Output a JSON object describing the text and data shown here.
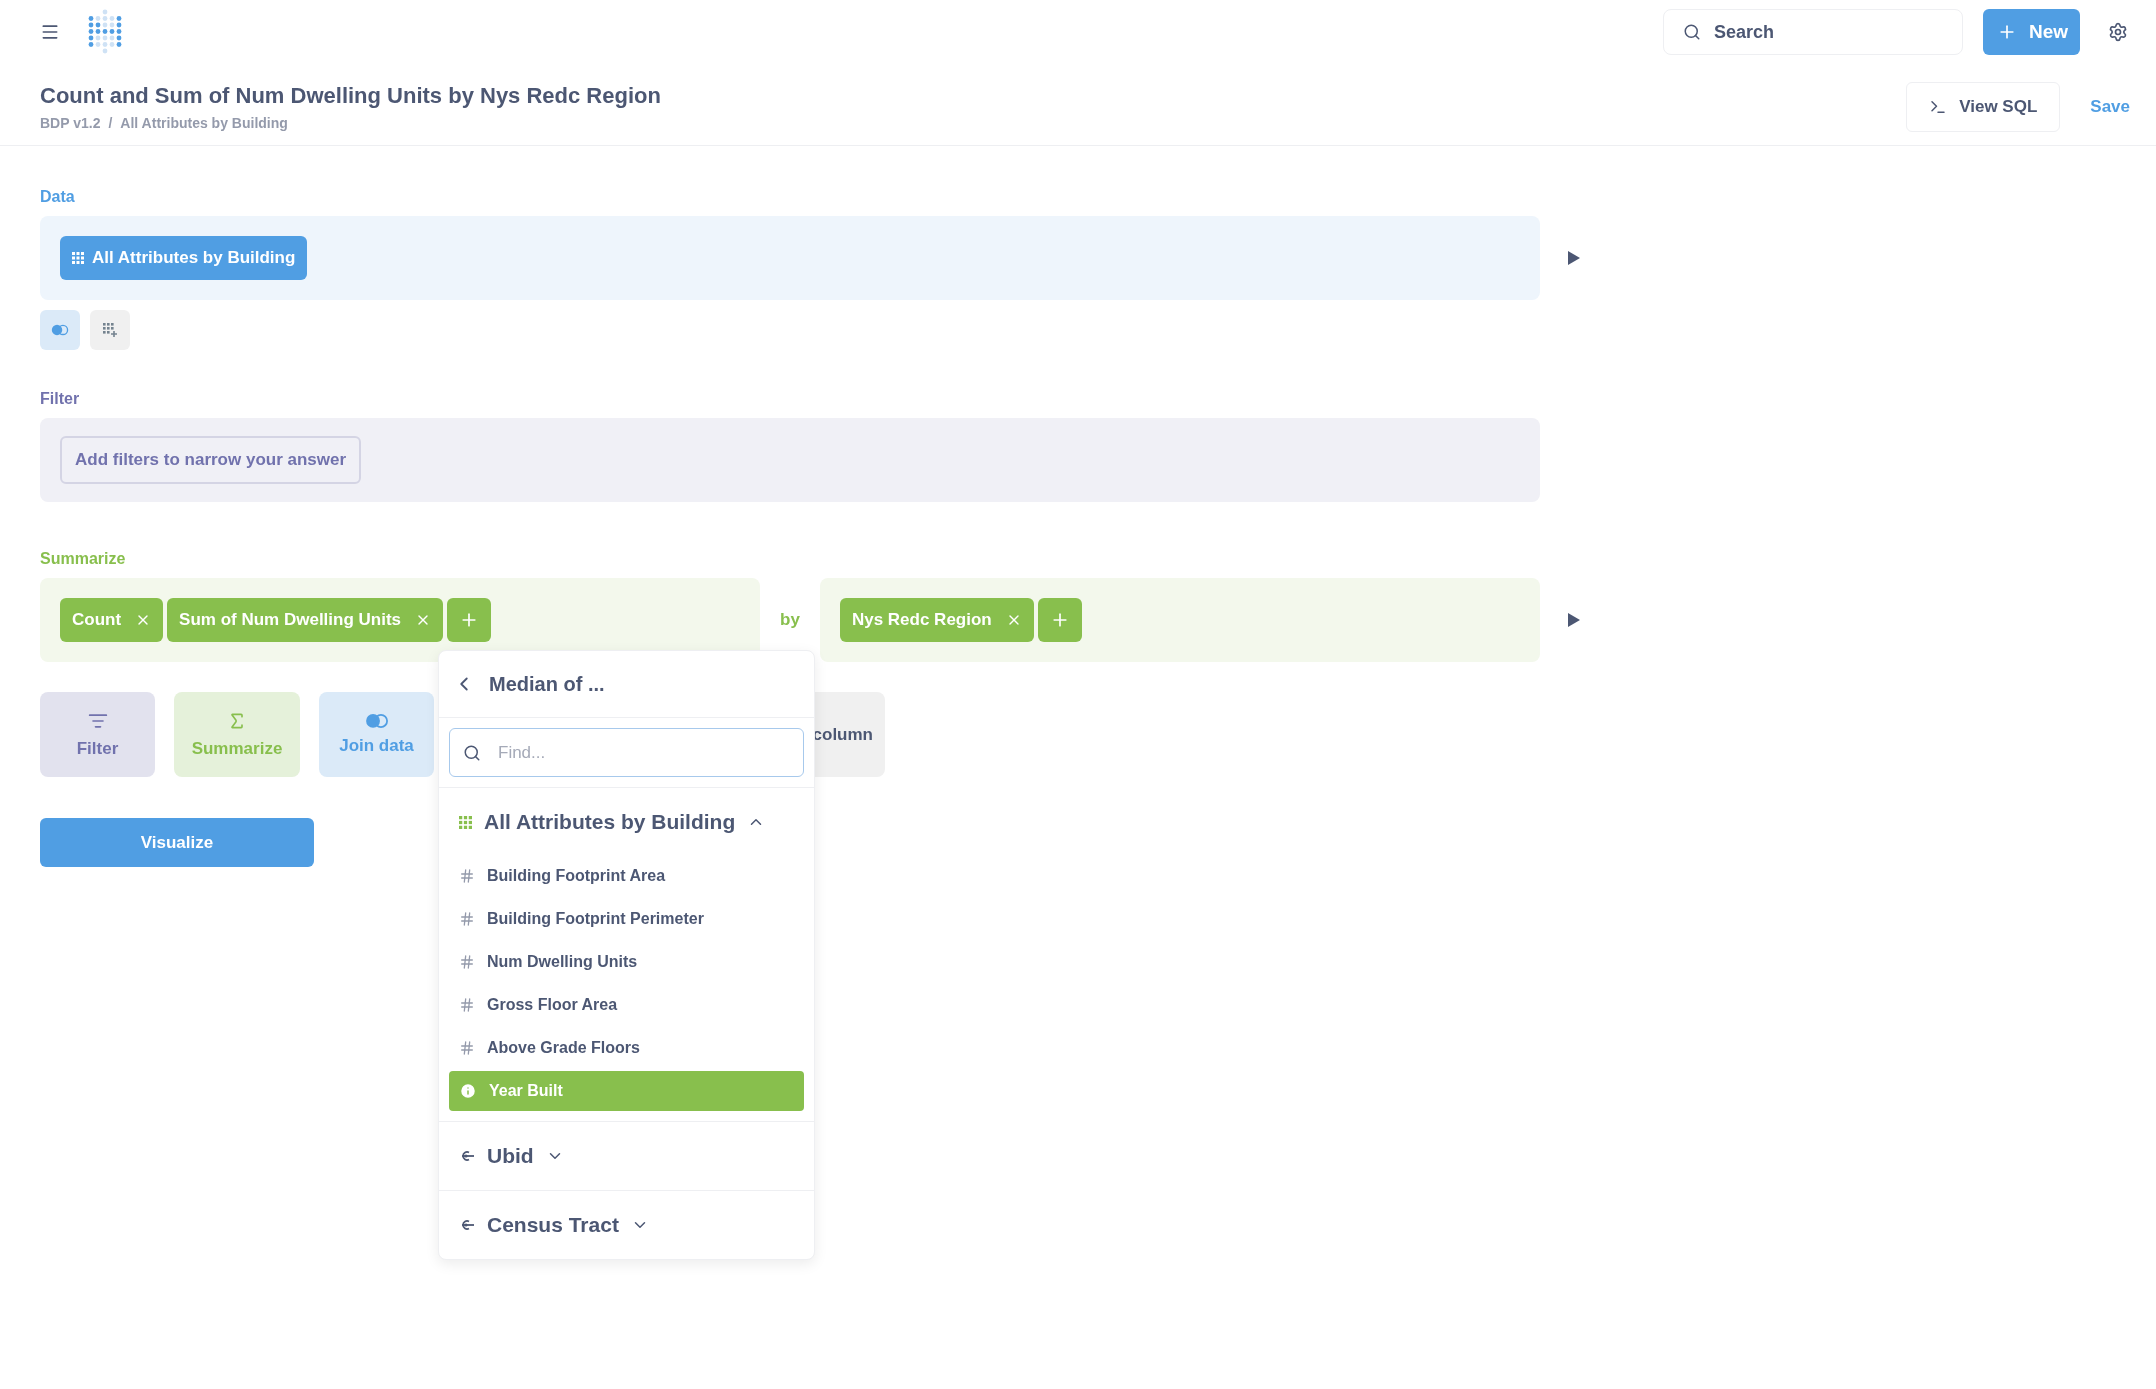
{
  "header": {
    "search": {
      "placeholder": "Search"
    },
    "new_button": "New"
  },
  "title": "Count and Sum of Num Dwelling Units by Nys Redc Region",
  "breadcrumbs": [
    "BDP v1.2",
    "All Attributes by Building"
  ],
  "breadcrumb_separator": "/",
  "header_actions": {
    "view_sql": "View SQL",
    "save": "Save"
  },
  "data": {
    "label": "Data",
    "source": "All Attributes by Building",
    "join_toggle": {
      "selected": true
    }
  },
  "filter": {
    "label": "Filter",
    "add_button": "Add filters to narrow your answer"
  },
  "summarize": {
    "label": "Summarize",
    "metrics": [
      "Count",
      "Sum of Num Dwelling Units"
    ],
    "by": "by",
    "groupings": [
      "Nys Redc Region"
    ]
  },
  "actions": [
    {
      "label": "Filter",
      "kind": "filter"
    },
    {
      "label": "Summarize",
      "kind": "summarize"
    },
    {
      "label": "Join data",
      "kind": "join"
    },
    {
      "label": "column",
      "kind": "custom"
    }
  ],
  "visualize": "Visualize",
  "popover": {
    "title": "Median of ...",
    "search": {
      "placeholder": "Find..."
    },
    "sections": [
      {
        "name": "All Attributes by Building",
        "kind": "table",
        "expanded": true,
        "columns": [
          {
            "name": "Building Footprint Area",
            "kind": "number",
            "selected": false
          },
          {
            "name": "Building Footprint Perimeter",
            "kind": "number",
            "selected": false
          },
          {
            "name": "Num Dwelling Units",
            "kind": "number",
            "selected": false
          },
          {
            "name": "Gross Floor Area",
            "kind": "number",
            "selected": false
          },
          {
            "name": "Above Grade Floors",
            "kind": "number",
            "selected": false
          },
          {
            "name": "Year Built",
            "kind": "info",
            "selected": true
          }
        ]
      },
      {
        "name": "Ubid",
        "kind": "link",
        "expanded": false
      },
      {
        "name": "Census Tract",
        "kind": "link",
        "expanded": false
      }
    ]
  }
}
